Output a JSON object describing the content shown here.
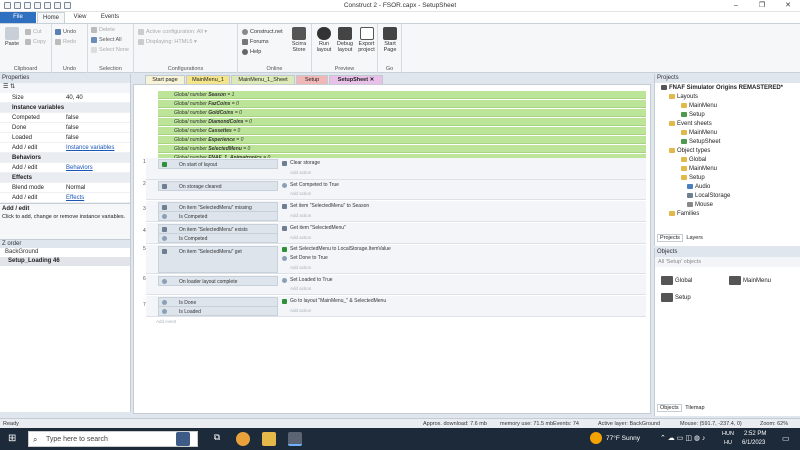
{
  "window": {
    "title": "Construct 2 - FSOR.capx - SetupSheet"
  },
  "ribbon_tabs": [
    "File",
    "Home",
    "View",
    "Events"
  ],
  "ribbon": {
    "clipboard": {
      "label": "Clipboard",
      "paste": "Paste",
      "cut": "Cut",
      "copy": "Copy"
    },
    "undo": {
      "label": "Undo",
      "undo": "Undo",
      "redo": "Redo"
    },
    "selection": {
      "label": "Selection",
      "delete": "Delete",
      "select_all": "Select All",
      "select_none": "Select None"
    },
    "configurations": {
      "label": "Configurations",
      "active": "Active configuration: All",
      "displaying": "Displaying: HTML5"
    },
    "online": {
      "label": "Online",
      "construct_net": "Construct.net",
      "forums": "Forums",
      "help": "Help",
      "store": "Scirra Store"
    },
    "preview": {
      "label": "Preview",
      "run": "Run layout",
      "debug": "Debug layout",
      "export": "Export project"
    },
    "go": {
      "label": "Go",
      "start_page": "Start Page"
    }
  },
  "properties": {
    "title": "Properties",
    "size": {
      "key": "Size",
      "value": "40, 40"
    },
    "instance_variables_header": "Instance variables",
    "rows": [
      {
        "key": "Competed",
        "value": "false"
      },
      {
        "key": "Done",
        "value": "false"
      },
      {
        "key": "Loaded",
        "value": "false"
      },
      {
        "key": "Add / edit",
        "value": "Instance variables"
      }
    ],
    "behaviors_header": "Behaviors",
    "behaviors_row": {
      "key": "Add / edit",
      "value": "Behaviors"
    },
    "effects_header": "Effects",
    "effects_rows": [
      {
        "key": "Blend mode",
        "value": "Normal"
      },
      {
        "key": "Add / edit",
        "value": "Effects"
      }
    ],
    "help_title": "Add / edit",
    "help_text": "Click to add, change or remove instance variables."
  },
  "zorder": {
    "title": "Z order",
    "items": [
      "BackGround",
      "Setup_Loading 46"
    ]
  },
  "doc_tabs": [
    "Start page",
    "MainMenu_1",
    "MainMenu_1_Sheet",
    "Setup",
    "SetupSheet"
  ],
  "globals": [
    {
      "text": "Global number ",
      "name": "Season",
      "value": " = 1"
    },
    {
      "text": "Global number ",
      "name": "FazCoins",
      "value": " = 0"
    },
    {
      "text": "Global number ",
      "name": "GoldCoins",
      "value": " = 0"
    },
    {
      "text": "Global number ",
      "name": "DiamondCoins",
      "value": " = 0"
    },
    {
      "text": "Global number ",
      "name": "Cassettes",
      "value": " = 0"
    },
    {
      "text": "Global number ",
      "name": "Experience",
      "value": " = 0"
    },
    {
      "text": "Global number ",
      "name": "SelectedMenu",
      "value": " = 0"
    },
    {
      "text": "Global number ",
      "name": "FNAF_1_Animatronics",
      "value": " = 0"
    }
  ],
  "events": [
    {
      "num": "1",
      "conds": [
        "On start of layout"
      ],
      "acts": [
        "Clear storage"
      ],
      "add_action": "Add action"
    },
    {
      "num": "2",
      "conds": [
        "On storage cleared"
      ],
      "acts": [
        "Set Competed to True"
      ],
      "add_action": "Add action"
    },
    {
      "num": "3",
      "conds": [
        "On item \"SelectedMenu\" missing",
        "Is Competed"
      ],
      "acts": [
        "Set item \"SelectedMenu\" to Season"
      ],
      "add_action": "Add action"
    },
    {
      "num": "4",
      "conds": [
        "On item \"SelectedMenu\" exists",
        "Is Competed"
      ],
      "acts": [
        "Get item \"SelectedMenu\""
      ],
      "add_action": "Add action"
    },
    {
      "num": "5",
      "conds": [
        "On item \"SelectedMenu\" get"
      ],
      "acts": [
        "Set SelectedMenu to LocalStorage.ItemValue",
        "Set Done to True"
      ],
      "add_action": "Add action"
    },
    {
      "num": "6",
      "conds": [
        "On loader layout complete"
      ],
      "acts": [
        "Set Loaded to True"
      ],
      "add_action": "Add action"
    },
    {
      "num": "7",
      "conds": [
        "Is Done",
        "Is Loaded"
      ],
      "acts": [
        "Go to layout \"MainMenu_\" & SelectedMenu"
      ],
      "add_action": "Add action"
    }
  ],
  "add_event": "Add event",
  "projects": {
    "title": "Projects",
    "root": "FNAF Simulator Origins REMASTERED*",
    "tree": [
      {
        "label": "Layouts",
        "level": 1
      },
      {
        "label": "MainMenu",
        "level": 2
      },
      {
        "label": "Setup",
        "level": 2
      },
      {
        "label": "Event sheets",
        "level": 1
      },
      {
        "label": "MainMenu",
        "level": 2
      },
      {
        "label": "SetupSheet",
        "level": 2
      },
      {
        "label": "Object types",
        "level": 1
      },
      {
        "label": "Global",
        "level": 2
      },
      {
        "label": "MainMenu",
        "level": 2
      },
      {
        "label": "Setup",
        "level": 2
      },
      {
        "label": "Audio",
        "level": 3
      },
      {
        "label": "LocalStorage",
        "level": 3
      },
      {
        "label": "Mouse",
        "level": 3
      },
      {
        "label": "Families",
        "level": 1
      }
    ],
    "tabs": [
      "Projects",
      "Layers"
    ]
  },
  "objects": {
    "title": "Objects",
    "filter": "All 'Setup' objects",
    "items": [
      "Global",
      "MainMenu",
      "Setup"
    ],
    "tabs": [
      "Objects",
      "Tilemap"
    ]
  },
  "status": {
    "ready": "Ready",
    "download": "Approx. download: 7.6 mb",
    "memory": "memory use: 71.5 mb",
    "events": "Events: 74",
    "layer": "Active layer: BackGround",
    "mouse": "Mouse: (591.7, -237.4, 0)",
    "zoom": "Zoom: 62%"
  },
  "taskbar": {
    "search": "Type here to search",
    "weather": "77°F  Sunny",
    "lang1": "HUN",
    "lang2": "HU",
    "time": "2:52 PM",
    "date": "6/1/2023"
  },
  "colors": {
    "accent": "#2f6fbf",
    "global_var_bg": "#bde59a",
    "taskbar": "#1c2a3a"
  }
}
